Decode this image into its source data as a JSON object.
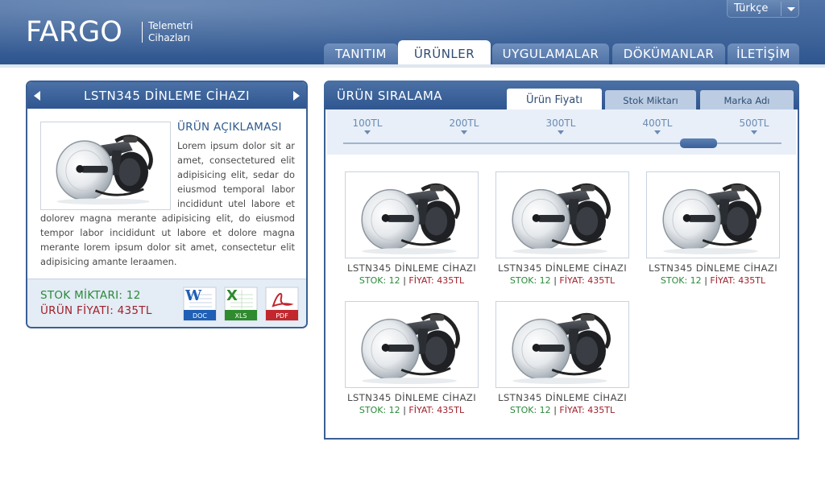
{
  "header": {
    "logo": "FARGO",
    "logo_sub_1": "Telemetri",
    "logo_sub_2": "Cihazları",
    "language": "Türkçe"
  },
  "nav": [
    {
      "label": "TANITIM"
    },
    {
      "label": "ÜRÜNLER"
    },
    {
      "label": "UYGULAMALAR"
    },
    {
      "label": "DÖKÜMANLAR"
    },
    {
      "label": "İLETİŞİM"
    }
  ],
  "detail": {
    "title": "LSTN345 DİNLEME CİHAZI",
    "subtitle": "ÜRÜN AÇIKLAMASI",
    "description": "Lorem ipsum dolor sit ar amet, consectetured elit adipisicing elit, sedar do eiusmod temporal labor incididunt utel labore et dolorev magna merante adipisicing elit, do eiusmod tempor labor incididunt ut labore et dolore magna merante lorem ipsum dolor sit amet, consectetur elit adipisicing amante leraamen.",
    "stock": "STOK MİKTARI: 12",
    "price": "ÜRÜN FİYATI: 435TL",
    "downloads": [
      {
        "label": "DOC",
        "color": "#1f5fb5"
      },
      {
        "label": "XLS",
        "color": "#2e8b2e"
      },
      {
        "label": "PDF",
        "color": "#c1272d"
      }
    ]
  },
  "sorting": {
    "title": "ÜRÜN SIRALAMA",
    "tabs": [
      {
        "label": "Ürün Fiyatı"
      },
      {
        "label": "Stok Miktarı"
      },
      {
        "label": "Marka Adı"
      }
    ],
    "ticks": [
      "100TL",
      "200TL",
      "300TL",
      "400TL",
      "500TL"
    ],
    "slider_value": "400TL"
  },
  "products": [
    {
      "name": "LSTN345 DİNLEME CİHAZI",
      "stock": "STOK: 12",
      "sep": "|",
      "price": "FİYAT: 435TL"
    },
    {
      "name": "LSTN345 DİNLEME CİHAZI",
      "stock": "STOK: 12",
      "sep": "|",
      "price": "FİYAT: 435TL"
    },
    {
      "name": "LSTN345 DİNLEME CİHAZI",
      "stock": "STOK: 12",
      "sep": "|",
      "price": "FİYAT: 435TL"
    },
    {
      "name": "LSTN345 DİNLEME CİHAZI",
      "stock": "STOK: 12",
      "sep": "|",
      "price": "FİYAT: 435TL"
    },
    {
      "name": "LSTN345 DİNLEME CİHAZI",
      "stock": "STOK: 12",
      "sep": "|",
      "price": "FİYAT: 435TL"
    }
  ]
}
